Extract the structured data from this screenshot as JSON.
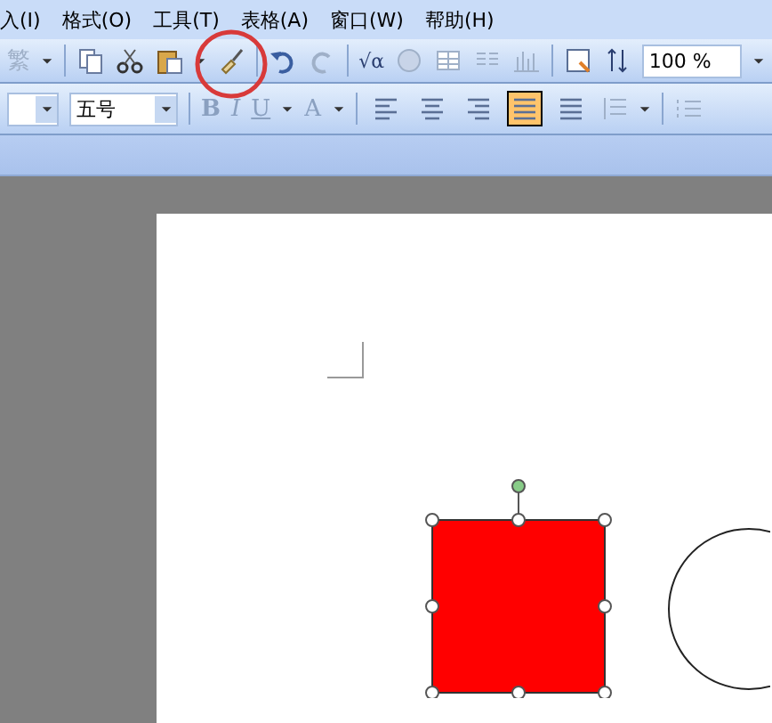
{
  "menu": [
    "入(I)",
    "格式(O)",
    "工具(T)",
    "表格(A)",
    "窗口(W)",
    "帮助(H)"
  ],
  "toolbar": {
    "traditional_glyph": "繁",
    "formula_glyph": "√α",
    "zoom": "100 %",
    "highlight_circle": true
  },
  "format_bar": {
    "font_size": "五号",
    "bold": "B",
    "italic": "I",
    "underline": "U",
    "font_color": "A",
    "alignments": [
      {
        "kind": "left",
        "selected": false
      },
      {
        "kind": "center",
        "selected": false
      },
      {
        "kind": "right",
        "selected": false
      },
      {
        "kind": "justify",
        "selected": true
      },
      {
        "kind": "distributed",
        "selected": false
      }
    ]
  },
  "canvas": {
    "shapes": [
      {
        "kind": "square",
        "color": "#ff0000",
        "selected": true
      },
      {
        "kind": "circle",
        "color": "#ffffff",
        "selected": false
      }
    ]
  }
}
